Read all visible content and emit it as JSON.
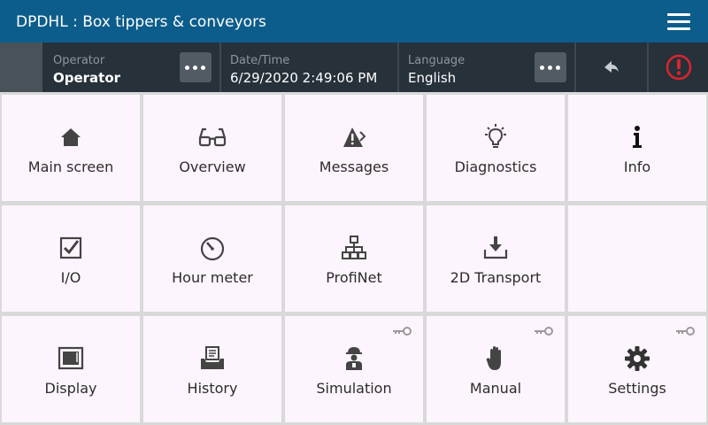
{
  "header": {
    "title": "DPDHL : Box tippers & conveyors",
    "menu_icon": "hamburger-menu-icon"
  },
  "infobar": {
    "operator": {
      "label": "Operator",
      "value": "Operator"
    },
    "datetime": {
      "label": "Date/Time",
      "value": "6/29/2020 2:49:06 PM"
    },
    "language": {
      "label": "Language",
      "value": "English"
    },
    "back_icon": "back-arrow-icon",
    "alarm_icon": "alarm-exclamation-icon",
    "alarm_color": "#d9252b"
  },
  "tiles": [
    {
      "label": "Main screen",
      "icon": "home-icon",
      "locked": false
    },
    {
      "label": "Overview",
      "icon": "glasses-icon",
      "locked": false
    },
    {
      "label": "Messages",
      "icon": "warning-messages-icon",
      "locked": false
    },
    {
      "label": "Diagnostics",
      "icon": "lightbulb-icon",
      "locked": false
    },
    {
      "label": "Info",
      "icon": "info-icon",
      "locked": false
    },
    {
      "label": "I/O",
      "icon": "checkbox-icon",
      "locked": false
    },
    {
      "label": "Hour meter",
      "icon": "gauge-icon",
      "locked": false
    },
    {
      "label": "ProfiNet",
      "icon": "network-icon",
      "locked": false
    },
    {
      "label": "2D Transport",
      "icon": "download-tray-icon",
      "locked": false
    },
    {
      "label": "",
      "icon": "",
      "locked": false
    },
    {
      "label": "Display",
      "icon": "display-icon",
      "locked": false
    },
    {
      "label": "History",
      "icon": "history-inbox-icon",
      "locked": false
    },
    {
      "label": "Simulation",
      "icon": "worker-icon",
      "locked": true
    },
    {
      "label": "Manual",
      "icon": "hand-icon",
      "locked": true
    },
    {
      "label": "Settings",
      "icon": "gear-icon",
      "locked": true
    }
  ]
}
